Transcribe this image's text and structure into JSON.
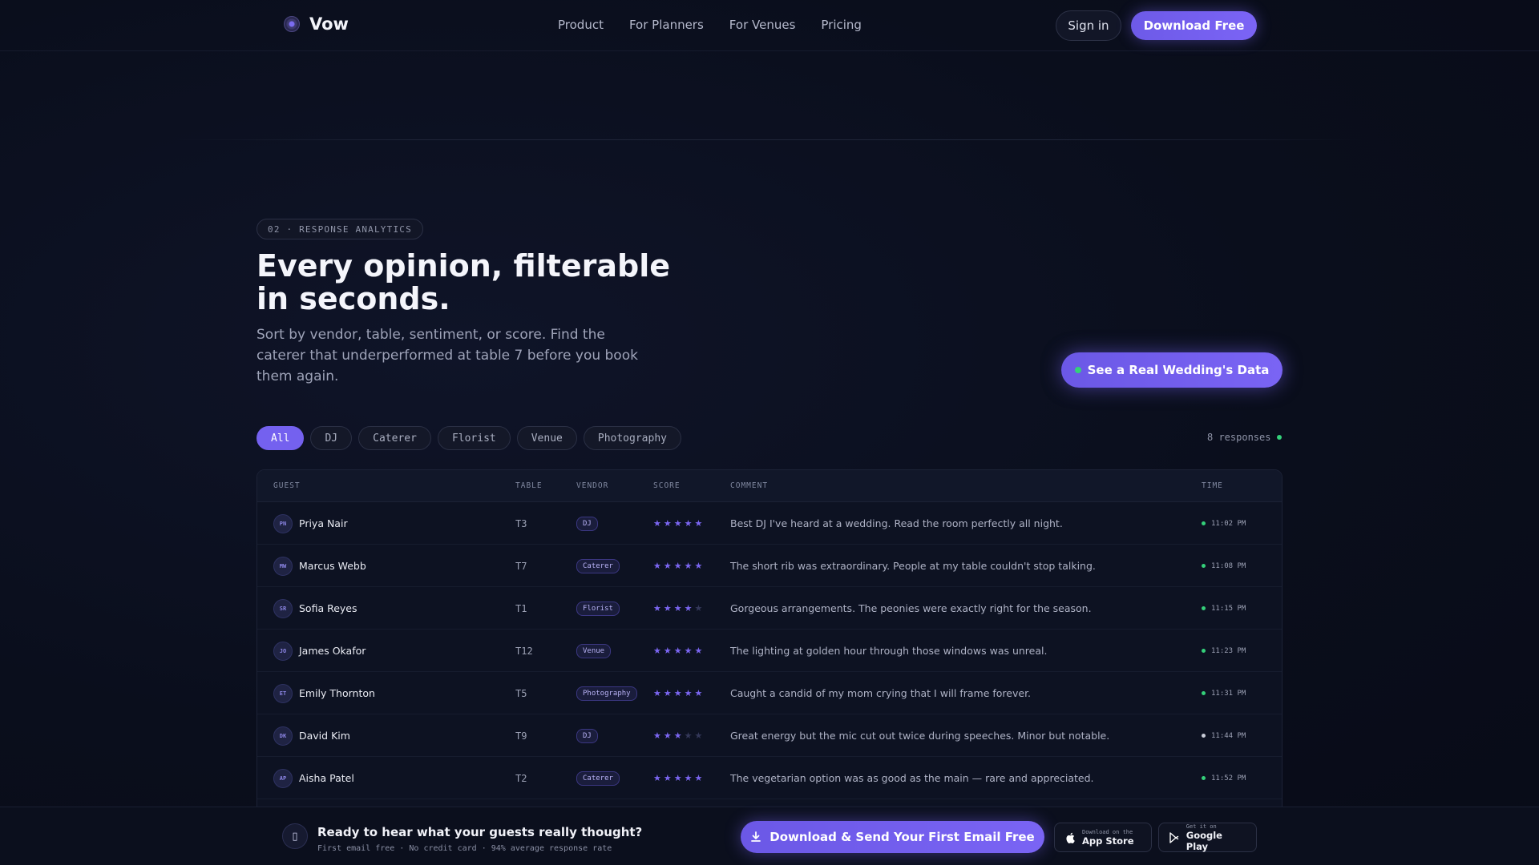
{
  "nav": {
    "brand": "Vow",
    "links": [
      "Product",
      "For Planners",
      "For Venues",
      "Pricing"
    ],
    "signin_label": "Sign in",
    "download_label": "Download Free"
  },
  "hero": {
    "eyebrow": "02 · RESPONSE ANALYTICS",
    "headline": "Every opinion, filterable in seconds.",
    "subtext": "Sort by vendor, table, sentiment, or score. Find the caterer that underperformed at table 7 before you book them again.",
    "cta_label": "See a Real Wedding's Data"
  },
  "filters": {
    "chips": [
      "All",
      "DJ",
      "Caterer",
      "Florist",
      "Venue",
      "Photography"
    ],
    "active": "All",
    "responses_label": "8 responses"
  },
  "table": {
    "columns": [
      "GUEST",
      "TABLE",
      "VENDOR",
      "SCORE",
      "COMMENT",
      "TIME"
    ],
    "rows": [
      {
        "initials": "PN",
        "guest": "Priya Nair",
        "table": "T3",
        "vendor": "DJ",
        "score": 5,
        "comment": "Best DJ I've heard at a wedding. Read the room perfectly all night.",
        "time": "11:02 PM",
        "status_color": "#34d07a"
      },
      {
        "initials": "MW",
        "guest": "Marcus Webb",
        "table": "T7",
        "vendor": "Caterer",
        "score": 5,
        "comment": "The short rib was extraordinary. People at my table couldn't stop talking.",
        "time": "11:08 PM",
        "status_color": "#34d07a"
      },
      {
        "initials": "SR",
        "guest": "Sofia Reyes",
        "table": "T1",
        "vendor": "Florist",
        "score": 4,
        "comment": "Gorgeous arrangements. The peonies were exactly right for the season.",
        "time": "11:15 PM",
        "status_color": "#34d07a"
      },
      {
        "initials": "JO",
        "guest": "James Okafor",
        "table": "T12",
        "vendor": "Venue",
        "score": 5,
        "comment": "The lighting at golden hour through those windows was unreal.",
        "time": "11:23 PM",
        "status_color": "#34d07a"
      },
      {
        "initials": "ET",
        "guest": "Emily Thornton",
        "table": "T5",
        "vendor": "Photography",
        "score": 5,
        "comment": "Caught a candid of my mom crying that I will frame forever.",
        "time": "11:31 PM",
        "status_color": "#34d07a"
      },
      {
        "initials": "DK",
        "guest": "David Kim",
        "table": "T9",
        "vendor": "DJ",
        "score": 3,
        "comment": "Great energy but the mic cut out twice during speeches. Minor but notable.",
        "time": "11:44 PM",
        "status_color": "#c9ccd8"
      },
      {
        "initials": "AP",
        "guest": "Aisha Patel",
        "table": "T2",
        "vendor": "Caterer",
        "score": 5,
        "comment": "The vegetarian option was as good as the main — rare and appreciated.",
        "time": "11:52 PM",
        "status_color": "#34d07a"
      }
    ]
  },
  "bottom_bar": {
    "icon": "phone-icon",
    "title": "Ready to hear what your guests really thought?",
    "subtitle": "First email free · No credit card · 94% average response rate",
    "cta_label": "Download & Send Your First Email Free",
    "app_store": {
      "small": "Download on the",
      "big": "App Store"
    },
    "google_play": {
      "small": "Get it on",
      "big": "Google Play"
    }
  },
  "colors": {
    "accent": "#7461ef",
    "positive": "#34d07a"
  }
}
